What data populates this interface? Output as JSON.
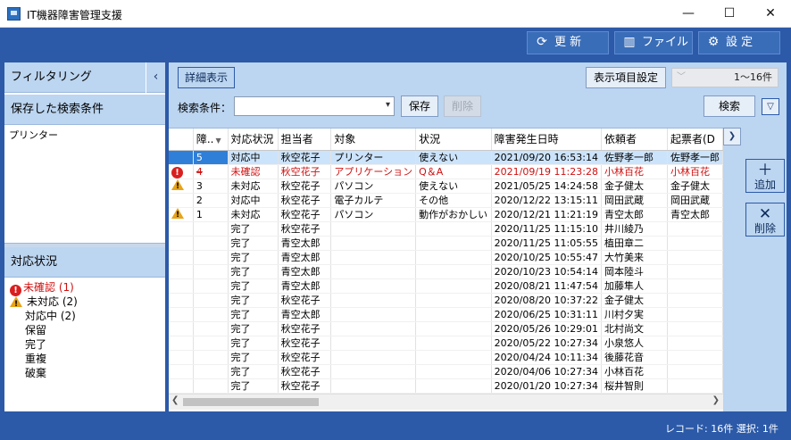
{
  "window": {
    "title": "IT機器障害管理支援",
    "min": "—",
    "max": "☐",
    "close": "✕"
  },
  "toolbar": {
    "refresh": "更 新",
    "file": "ファイル",
    "settings": "設 定"
  },
  "left": {
    "filter_header": "フィルタリング",
    "collapse": "‹",
    "saved_header": "保存した検索条件",
    "saved_items": [
      "プリンター"
    ],
    "status_header": "対応状況",
    "status_items": [
      {
        "label": "未確認 (1)",
        "icon": "error-icon"
      },
      {
        "label": "未対応 (2)",
        "icon": "warning-icon"
      },
      {
        "label": "対応中 (2)",
        "icon": ""
      },
      {
        "label": "保留",
        "icon": ""
      },
      {
        "label": "完了",
        "icon": ""
      },
      {
        "label": "重複",
        "icon": ""
      },
      {
        "label": "破棄",
        "icon": ""
      }
    ]
  },
  "right": {
    "detail_button": "詳細表示",
    "columns_button": "表示項目設定",
    "page_range": "1～16件",
    "search_label": "検索条件：",
    "search_value": "",
    "save_button": "保存",
    "delete_button": "削除",
    "search_button": "検索",
    "add_button": "追加",
    "remove_button": "削除"
  },
  "grid": {
    "headers": [
      "障..",
      "対応状況",
      "担当者",
      "対象",
      "状況",
      "障害発生日時",
      "依頼者",
      "起票者(D"
    ],
    "rows": [
      {
        "icon": "",
        "id": "5",
        "status": "対応中",
        "owner": "秋空花子",
        "target": "プリンター",
        "state": "使えない",
        "date": "2021/09/20 16:53:14",
        "req": "佐野孝一郎",
        "rep": "佐野孝一郎"
      },
      {
        "icon": "error",
        "id": "4",
        "status": "未確認",
        "owner": "秋空花子",
        "target": "アプリケーション",
        "state": "Q＆A",
        "date": "2021/09/19 11:23:28",
        "req": "小林百花",
        "rep": "小林百花"
      },
      {
        "icon": "warning",
        "id": "3",
        "status": "未対応",
        "owner": "秋空花子",
        "target": "パソコン",
        "state": "使えない",
        "date": "2021/05/25 14:24:58",
        "req": "金子健太",
        "rep": "金子健太"
      },
      {
        "icon": "",
        "id": "2",
        "status": "対応中",
        "owner": "秋空花子",
        "target": "電子カルテ",
        "state": "その他",
        "date": "2020/12/22 13:15:11",
        "req": "岡田武蔵",
        "rep": "岡田武蔵"
      },
      {
        "icon": "warning",
        "id": "1",
        "status": "未対応",
        "owner": "秋空花子",
        "target": "パソコン",
        "state": "動作がおかしい",
        "date": "2020/12/21 11:21:19",
        "req": "青空太郎",
        "rep": "青空太郎"
      },
      {
        "icon": "",
        "id": "",
        "status": "完了",
        "owner": "秋空花子",
        "target": "",
        "state": "",
        "date": "2020/11/25 11:15:10",
        "req": "井川綾乃",
        "rep": ""
      },
      {
        "icon": "",
        "id": "",
        "status": "完了",
        "owner": "青空太郎",
        "target": "",
        "state": "",
        "date": "2020/11/25 11:05:55",
        "req": "植田章二",
        "rep": ""
      },
      {
        "icon": "",
        "id": "",
        "status": "完了",
        "owner": "青空太郎",
        "target": "",
        "state": "",
        "date": "2020/10/25 10:55:47",
        "req": "大竹美来",
        "rep": ""
      },
      {
        "icon": "",
        "id": "",
        "status": "完了",
        "owner": "青空太郎",
        "target": "",
        "state": "",
        "date": "2020/10/23 10:54:14",
        "req": "岡本陸斗",
        "rep": ""
      },
      {
        "icon": "",
        "id": "",
        "status": "完了",
        "owner": "青空太郎",
        "target": "",
        "state": "",
        "date": "2020/08/21 11:47:54",
        "req": "加藤隼人",
        "rep": ""
      },
      {
        "icon": "",
        "id": "",
        "status": "完了",
        "owner": "秋空花子",
        "target": "",
        "state": "",
        "date": "2020/08/20 10:37:22",
        "req": "金子健太",
        "rep": ""
      },
      {
        "icon": "",
        "id": "",
        "status": "完了",
        "owner": "青空太郎",
        "target": "",
        "state": "",
        "date": "2020/06/25 10:31:11",
        "req": "川村夕実",
        "rep": ""
      },
      {
        "icon": "",
        "id": "",
        "status": "完了",
        "owner": "秋空花子",
        "target": "",
        "state": "",
        "date": "2020/05/26 10:29:01",
        "req": "北村尚文",
        "rep": ""
      },
      {
        "icon": "",
        "id": "",
        "status": "完了",
        "owner": "秋空花子",
        "target": "",
        "state": "",
        "date": "2020/05/22 10:27:34",
        "req": "小泉悠人",
        "rep": ""
      },
      {
        "icon": "",
        "id": "",
        "status": "完了",
        "owner": "秋空花子",
        "target": "",
        "state": "",
        "date": "2020/04/24 10:11:34",
        "req": "後藤花音",
        "rep": ""
      },
      {
        "icon": "",
        "id": "",
        "status": "完了",
        "owner": "秋空花子",
        "target": "",
        "state": "",
        "date": "2020/04/06 10:27:34",
        "req": "小林百花",
        "rep": ""
      },
      {
        "icon": "",
        "id": "",
        "status": "完了",
        "owner": "秋空花子",
        "target": "",
        "state": "",
        "date": "2020/01/20 10:27:34",
        "req": "桜井智則",
        "rep": ""
      }
    ]
  },
  "statusbar": {
    "text": "レコード: 16件  選択: 1件"
  },
  "colors": {
    "frame": "#2c5aa8",
    "panel": "#bcd5f0",
    "selected": "#cce4fb",
    "alert": "#d01010"
  }
}
